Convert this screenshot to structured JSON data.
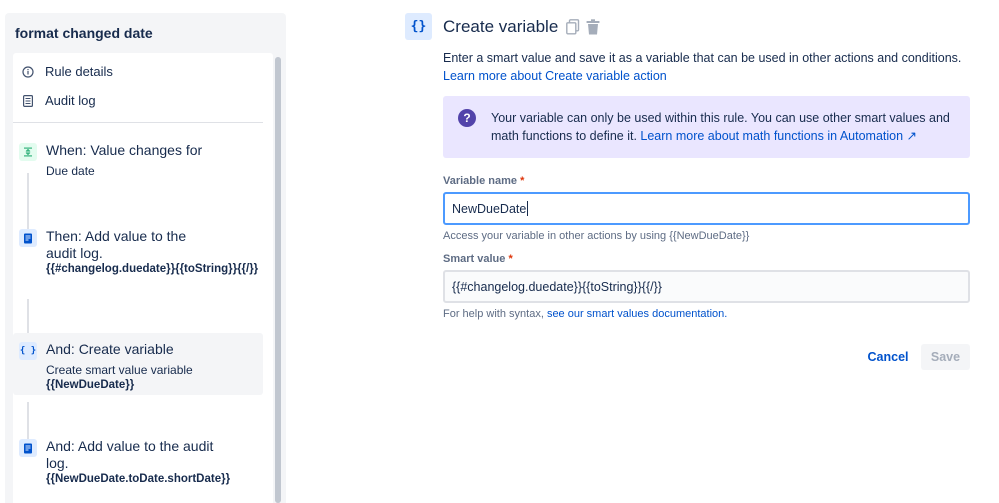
{
  "sidebar": {
    "rule_title": "format changed date",
    "nav": [
      {
        "label": "Rule details",
        "icon": "info-icon"
      },
      {
        "label": "Audit log",
        "icon": "document-icon"
      }
    ],
    "steps": [
      {
        "title": "When: Value changes for",
        "desc": "Due date",
        "code": "",
        "icon": "trigger-icon",
        "selected": false
      },
      {
        "title": "Then: Add value to the audit log.",
        "desc": "",
        "code": "{{#changelog.duedate}}{{toString}}{{/}}",
        "icon": "audit-log-icon",
        "selected": false
      },
      {
        "title": "And: Create variable",
        "desc": "Create smart value variable",
        "code": "{{NewDueDate}}",
        "icon": "braces-icon",
        "selected": true
      },
      {
        "title": "And: Add value to the audit log.",
        "desc": "",
        "code": "{{NewDueDate.toDate.shortDate}}",
        "icon": "audit-log-icon",
        "selected": false
      }
    ]
  },
  "main": {
    "icon_glyph": "{}",
    "title": "Create variable",
    "intro": "Enter a smart value and save it as a variable that can be used in other actions and conditions.",
    "intro_link": "Learn more about Create variable action",
    "info": {
      "text": "Your variable can only be used within this rule. You can use other smart values and math functions to define it.",
      "link": "Learn more about math functions in Automation ↗"
    },
    "variable_name": {
      "label": "Variable name",
      "required": "*",
      "value": "NewDueDate",
      "helper": "Access your variable in other actions by using {{NewDueDate}}"
    },
    "smart_value": {
      "label": "Smart value",
      "required": "*",
      "value": "{{#changelog.duedate}}{{toString}}{{/}}",
      "helper": "For help with syntax,",
      "helper_link": "see our smart values documentation."
    },
    "buttons": {
      "cancel": "Cancel",
      "save": "Save"
    }
  },
  "colors": {
    "accent": "#0052CC",
    "info_bg": "#EAE6FF",
    "focus_border": "#4C9AFF",
    "trigger_green": "#36B37E",
    "required_red": "#DE350B"
  }
}
